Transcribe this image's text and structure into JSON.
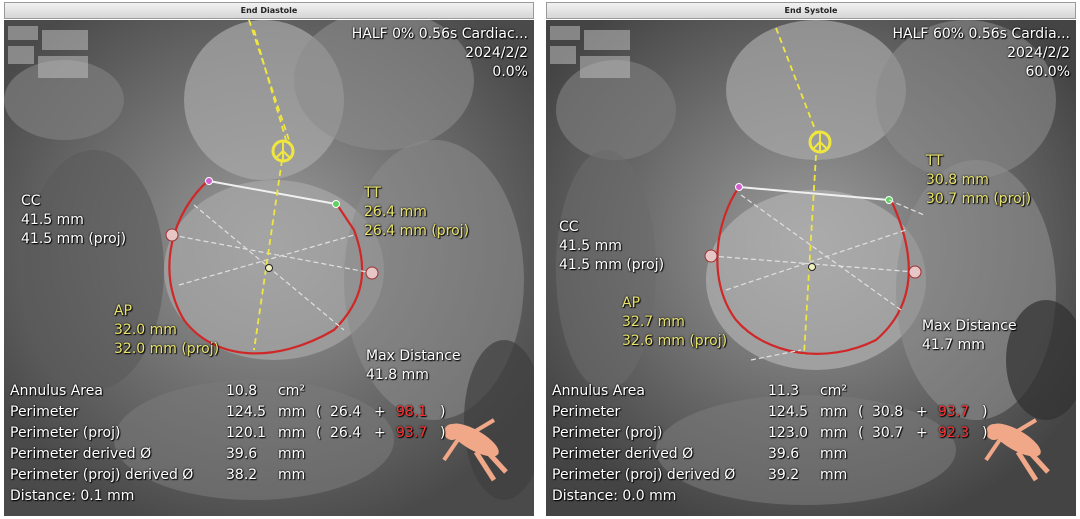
{
  "viewports": [
    {
      "header": "End Diastole",
      "info": {
        "line1": "HALF 0% 0.56s Cardiac...",
        "line2": "2024/2/2",
        "line3": "0.0%"
      },
      "cc": {
        "label": "CC",
        "v1": "41.5 mm",
        "v2": "41.5 mm (proj)"
      },
      "tt": {
        "label": "TT",
        "v1": "26.4 mm",
        "v2": "26.4 mm (proj)"
      },
      "ap": {
        "label": "AP",
        "v1": "32.0 mm",
        "v2": "32.0 mm (proj)"
      },
      "maxdist": {
        "label": "Max Distance",
        "v1": "41.8 mm"
      },
      "measurements": {
        "area": {
          "label": "Annulus Area",
          "value": "10.8",
          "unit": "cm²"
        },
        "perimeter": {
          "label": "Perimeter",
          "value": "124.5",
          "unit": "mm",
          "open": "(",
          "a": "26.4",
          "plus": "+",
          "b": "98.1",
          "close": ")"
        },
        "perimeter_proj": {
          "label": "Perimeter (proj)",
          "value": "120.1",
          "unit": "mm",
          "open": "(",
          "a": "26.4",
          "plus": "+",
          "b": "93.7",
          "close": ")"
        },
        "perim_derived": {
          "label": "Perimeter derived Ø",
          "value": "39.6",
          "unit": "mm"
        },
        "perim_proj_derived": {
          "label": "Perimeter (proj) derived Ø",
          "value": "38.2",
          "unit": "mm"
        },
        "distance": {
          "label": "Distance: 0.1 mm"
        }
      }
    },
    {
      "header": "End Systole",
      "info": {
        "line1": "HALF 60% 0.56s Cardia...",
        "line2": "2024/2/2",
        "line3": "60.0%"
      },
      "cc": {
        "label": "CC",
        "v1": "41.5 mm",
        "v2": "41.5 mm (proj)"
      },
      "tt": {
        "label": "TT",
        "v1": "30.8 mm",
        "v2": "30.7 mm (proj)"
      },
      "ap": {
        "label": "AP",
        "v1": "32.7 mm",
        "v2": "32.6 mm (proj)"
      },
      "maxdist": {
        "label": "Max Distance",
        "v1": "41.7 mm"
      },
      "measurements": {
        "area": {
          "label": "Annulus Area",
          "value": "11.3",
          "unit": "cm²"
        },
        "perimeter": {
          "label": "Perimeter",
          "value": "124.5",
          "unit": "mm",
          "open": "(",
          "a": "30.8",
          "plus": "+",
          "b": "93.7",
          "close": ")"
        },
        "perimeter_proj": {
          "label": "Perimeter (proj)",
          "value": "123.0",
          "unit": "mm",
          "open": "(",
          "a": "30.7",
          "plus": "+",
          "b": "92.3",
          "close": ")"
        },
        "perim_derived": {
          "label": "Perimeter derived Ø",
          "value": "39.6",
          "unit": "mm"
        },
        "perim_proj_derived": {
          "label": "Perimeter (proj) derived Ø",
          "value": "39.2",
          "unit": "mm"
        },
        "distance": {
          "label": "Distance: 0.0 mm"
        }
      }
    }
  ],
  "icons": {
    "orientation": "body-orientation-figure-icon",
    "centerline": "peace-symbol-icon"
  },
  "colors": {
    "annulus": "#d02828",
    "measure_text": "#e8e26a",
    "highlight": "#ff3030",
    "centerline": "#f0e640"
  }
}
